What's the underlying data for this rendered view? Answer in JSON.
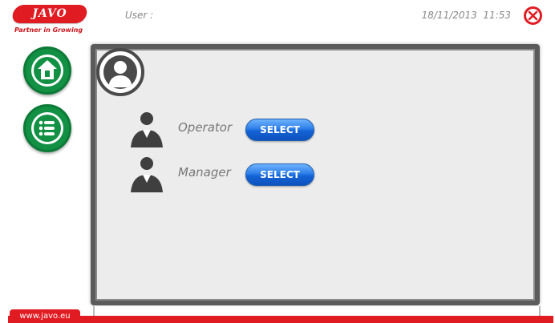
{
  "header": {
    "logo_text": "JAVO",
    "tagline": "Partner in Growing",
    "user_label": "User :",
    "datetime": "18/11/2013  11:53",
    "close_icon": "close-icon"
  },
  "nav": {
    "home_icon": "home-icon",
    "menu_icon": "list-icon"
  },
  "panel": {
    "avatar_icon": "user-icon",
    "roles": [
      {
        "label": "Operator",
        "button": "SELECT"
      },
      {
        "label": "Manager",
        "button": "SELECT"
      }
    ]
  },
  "footer": {
    "url": "www.javo.eu"
  },
  "colors": {
    "brand_red": "#e11b22",
    "nav_green": "#129044",
    "select_blue": "#1463d6"
  }
}
